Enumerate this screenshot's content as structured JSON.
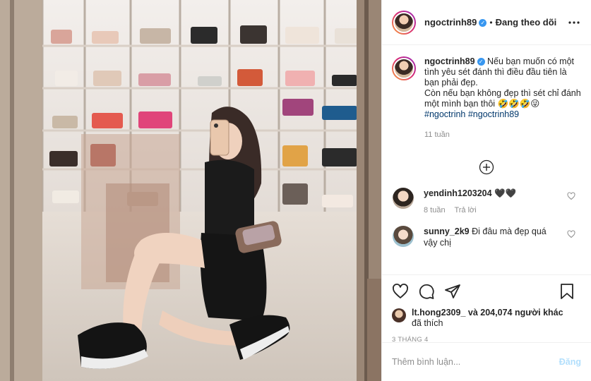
{
  "post": {
    "username": "ngoctrinh89",
    "follow_label": "Đang theo dõi",
    "more_icon": "more-horizontal-icon",
    "verified_icon": "verified-badge-icon",
    "verified_glyph": "✓",
    "separator": "•",
    "caption_text": "Nếu bạn muốn có một tình yêu sét đánh thì điều đầu tiên là bạn phải đẹp.",
    "caption_text_2": "Còn nếu bạn không đẹp thì sét chỉ đánh một mình bạn thôi",
    "caption_emojis": "🤣🤣🤣😜",
    "hashtags": [
      "#ngoctrinh",
      "#ngoctrinh89"
    ],
    "caption_time": "11 tuần",
    "likes_user": "lt.hong2309_",
    "likes_rest": "và 204,074 người khác",
    "likes_suffix": "đã thích",
    "date": "3 THÁNG 4",
    "comment_placeholder": "Thêm bình luận...",
    "post_label": "Đăng"
  },
  "comments": [
    {
      "username": "yendinh1203204",
      "text": "🖤🖤",
      "time": "8 tuần",
      "reply_label": "Trả lời"
    },
    {
      "username": "sunny_2k9",
      "text": "Đi đâu mà đẹp quá vậy chị",
      "time": "",
      "reply_label": ""
    }
  ],
  "colors": {
    "link": "#00376b",
    "muted": "#8e8e8e",
    "post_button_disabled": "#b2dffc",
    "verified": "#3897f0"
  }
}
